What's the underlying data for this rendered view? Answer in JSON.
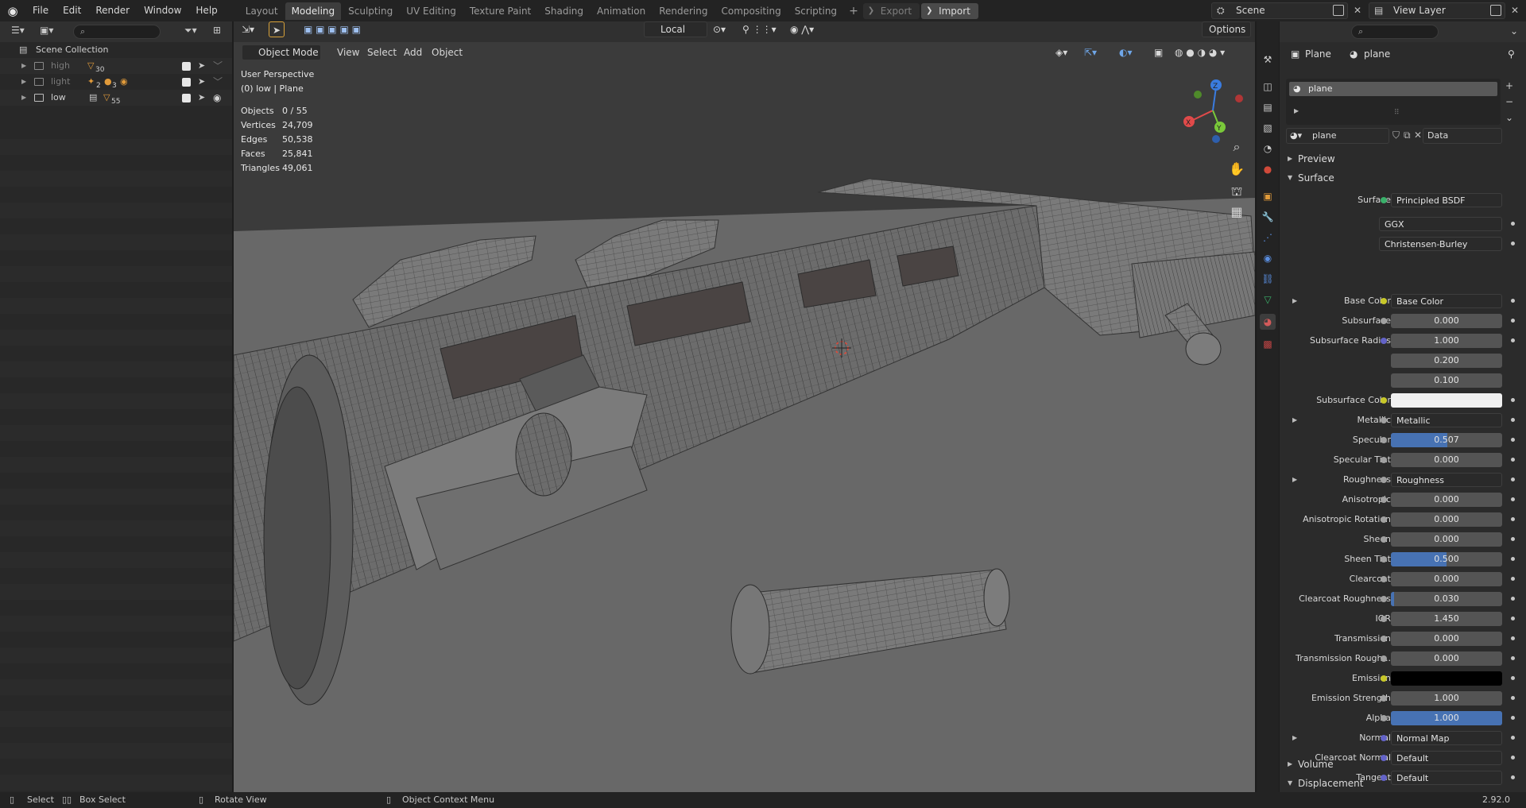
{
  "app": {
    "menus": [
      "File",
      "Edit",
      "Render",
      "Window",
      "Help"
    ],
    "workspaces": [
      "Layout",
      "Modeling",
      "Sculpting",
      "UV Editing",
      "Texture Paint",
      "Shading",
      "Animation",
      "Rendering",
      "Compositing",
      "Scripting"
    ],
    "active_workspace": "Modeling",
    "export_label": "Export",
    "import_label": "Import",
    "scene": "Scene",
    "view_layer": "View Layer"
  },
  "outliner": {
    "root": "Scene Collection",
    "collections": [
      {
        "name": "high",
        "badge": "30",
        "dimmed": true
      },
      {
        "name": "light",
        "badge_a": "2",
        "badge_b": "3",
        "dimmed": true
      },
      {
        "name": "low",
        "badge": "55",
        "dimmed": false
      }
    ]
  },
  "viewport": {
    "mode": "Object Mode",
    "menus": [
      "View",
      "Select",
      "Add",
      "Object"
    ],
    "transform_orientation": "Local",
    "options_label": "Options",
    "perspective": "User Perspective",
    "context": "(0) low | Plane",
    "stats": [
      {
        "label": "Objects",
        "value": "0 / 55"
      },
      {
        "label": "Vertices",
        "value": "24,709"
      },
      {
        "label": "Edges",
        "value": "50,538"
      },
      {
        "label": "Faces",
        "value": "25,841"
      },
      {
        "label": "Triangles",
        "value": "49,061"
      }
    ],
    "gizmo": {
      "x": "X",
      "y": "Y",
      "z": "Z"
    }
  },
  "properties": {
    "object_crumb": "Plane",
    "material_crumb": "plane",
    "slot": "plane",
    "material_name": "plane",
    "link_mode": "Data",
    "panels": {
      "preview": "Preview",
      "surface": "Surface",
      "volume": "Volume",
      "displacement": "Displacement"
    },
    "surface_shader": "Principled BSDF",
    "distribution": "GGX",
    "subsurface_method": "Christensen-Burley",
    "rows": [
      {
        "label": "Base Color",
        "value": "Base Color",
        "kind": "link",
        "expand": true,
        "sock": "#c7c729"
      },
      {
        "label": "Subsurface",
        "value": "0.000",
        "kind": "num",
        "sock": "#a1a1a1"
      },
      {
        "label": "Subsurface Radius",
        "value": "1.000",
        "kind": "num",
        "sock": "#6363c7"
      },
      {
        "label": "",
        "value": "0.200",
        "kind": "num",
        "sock": ""
      },
      {
        "label": "",
        "value": "0.100",
        "kind": "num",
        "sock": ""
      },
      {
        "label": "Subsurface Color",
        "value": "",
        "kind": "color",
        "color": "#f0f0f0",
        "sock": "#c7c729"
      },
      {
        "label": "Metallic",
        "value": "Metallic",
        "kind": "link",
        "expand": true,
        "sock": "#a1a1a1"
      },
      {
        "label": "Specular",
        "value": "0.507",
        "kind": "num",
        "fill": 0.507,
        "sock": "#a1a1a1"
      },
      {
        "label": "Specular Tint",
        "value": "0.000",
        "kind": "num",
        "sock": "#a1a1a1"
      },
      {
        "label": "Roughness",
        "value": "Roughness",
        "kind": "link",
        "expand": true,
        "sock": "#a1a1a1"
      },
      {
        "label": "Anisotropic",
        "value": "0.000",
        "kind": "num",
        "sock": "#a1a1a1"
      },
      {
        "label": "Anisotropic Rotation",
        "value": "0.000",
        "kind": "num",
        "sock": "#a1a1a1"
      },
      {
        "label": "Sheen",
        "value": "0.000",
        "kind": "num",
        "sock": "#a1a1a1"
      },
      {
        "label": "Sheen Tint",
        "value": "0.500",
        "kind": "num",
        "fill": 0.5,
        "sock": "#a1a1a1"
      },
      {
        "label": "Clearcoat",
        "value": "0.000",
        "kind": "num",
        "sock": "#a1a1a1"
      },
      {
        "label": "Clearcoat Roughness",
        "value": "0.030",
        "kind": "num",
        "fill": 0.03,
        "sock": "#a1a1a1"
      },
      {
        "label": "IOR",
        "value": "1.450",
        "kind": "num",
        "sock": "#a1a1a1"
      },
      {
        "label": "Transmission",
        "value": "0.000",
        "kind": "num",
        "sock": "#a1a1a1"
      },
      {
        "label": "Transmission Rough...",
        "value": "0.000",
        "kind": "num",
        "sock": "#a1a1a1"
      },
      {
        "label": "Emission",
        "value": "",
        "kind": "color",
        "color": "#000000",
        "sock": "#c7c729"
      },
      {
        "label": "Emission Strength",
        "value": "1.000",
        "kind": "num",
        "sock": "#a1a1a1"
      },
      {
        "label": "Alpha",
        "value": "1.000",
        "kind": "num",
        "fill": 1.0,
        "sock": "#a1a1a1"
      },
      {
        "label": "Normal",
        "value": "Normal Map",
        "kind": "link",
        "expand": true,
        "sock": "#6363c7"
      },
      {
        "label": "Clearcoat Normal",
        "value": "Default",
        "kind": "link",
        "sock": "#6363c7"
      },
      {
        "label": "Tangent",
        "value": "Default",
        "kind": "link",
        "sock": "#6363c7"
      }
    ]
  },
  "statusbar": {
    "select": "Select",
    "box_select": "Box Select",
    "rotate": "Rotate View",
    "context_menu": "Object Context Menu",
    "version": "2.92.0"
  },
  "colors": {
    "accent": "#4772b3",
    "active_tab": "#3d3d3d",
    "object_icon": "#e09a3a"
  }
}
